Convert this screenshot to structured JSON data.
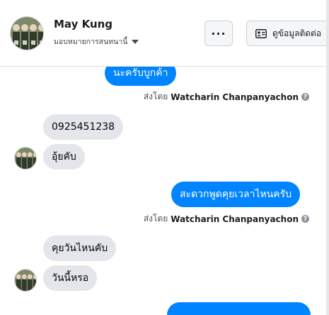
{
  "header": {
    "name": "May Kung",
    "assign_label": "มอบหมายการสนทนานี้",
    "more_label": "...",
    "contact_label": "ดูข้อมูลติดต่อ"
  },
  "messages": [
    {
      "direction": "out",
      "text": "นะครับบูกค้า"
    },
    {
      "direction": "meta",
      "prefix": "ส่งโดย",
      "author": "Watcharin Chanpanyachon"
    },
    {
      "direction": "in",
      "text": "0925451238"
    },
    {
      "direction": "in",
      "text": "อุ้ยคับ"
    },
    {
      "direction": "out",
      "text": "สะดวกพูดคุยเวลาไหนครับ"
    },
    {
      "direction": "meta",
      "prefix": "ส่งโดย",
      "author": "Watcharin Chanpanyachon"
    },
    {
      "direction": "in",
      "text": "คุยวันไหนคับ"
    },
    {
      "direction": "in",
      "text": "วันนี้หรอ"
    }
  ],
  "colors": {
    "outgoing_bubble": "#0084ff",
    "incoming_bubble": "#e4e6eb",
    "header_border": "#dddfe2"
  },
  "icons": {
    "more": "ellipsis-icon",
    "contact": "contact-card-icon",
    "dropdown": "caret-down-icon",
    "info": "info-icon"
  }
}
